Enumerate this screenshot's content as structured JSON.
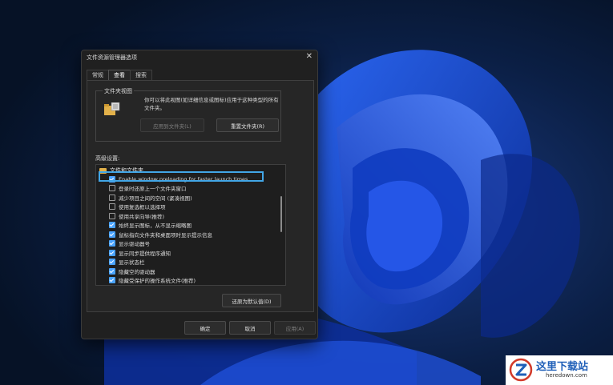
{
  "dialog": {
    "title": "文件资源管理器选项",
    "close_glyph": "✕",
    "tabs": [
      "常规",
      "查看",
      "搜索"
    ],
    "active_tab": "查看",
    "folder_view": {
      "legend": "文件夹视图",
      "description": "你可以将此视图(如详细信息或图标)应用于这种类型的所有文件夹。",
      "apply_button": "应用到文件夹(L)",
      "reset_button": "重置文件夹(R)"
    },
    "advanced_label": "高级设置:",
    "tree_root": "文件和文件夹",
    "items": [
      {
        "label": "Enable window preloading for faster launch times",
        "checked": true
      },
      {
        "label": "登录时还原上一个文件夹窗口",
        "checked": false
      },
      {
        "label": "减少项目之间的空间 (紧凑视图)",
        "checked": false
      },
      {
        "label": "使用复选框以选择项",
        "checked": false
      },
      {
        "label": "使用共享向导(推荐)",
        "checked": false
      },
      {
        "label": "始终显示图标，从不显示缩略图",
        "checked": true
      },
      {
        "label": "鼠标指向文件夹和桌面项时显示提示信息",
        "checked": true
      },
      {
        "label": "显示驱动器号",
        "checked": true
      },
      {
        "label": "显示同步提供程序通知",
        "checked": true
      },
      {
        "label": "显示状态栏",
        "checked": true
      },
      {
        "label": "隐藏空的驱动器",
        "checked": true
      },
      {
        "label": "隐藏受保护的操作系统文件(推荐)",
        "checked": true
      }
    ],
    "restore_defaults": "还原为默认值(D)",
    "ok": "确定",
    "cancel": "取消",
    "apply": "应用(A)"
  },
  "watermark": {
    "name": "这里下载站",
    "url": "heredown.com"
  },
  "colors": {
    "accent": "#4aa3ff",
    "highlight_box": "#42a6e6",
    "dialog_bg": "#202020"
  }
}
